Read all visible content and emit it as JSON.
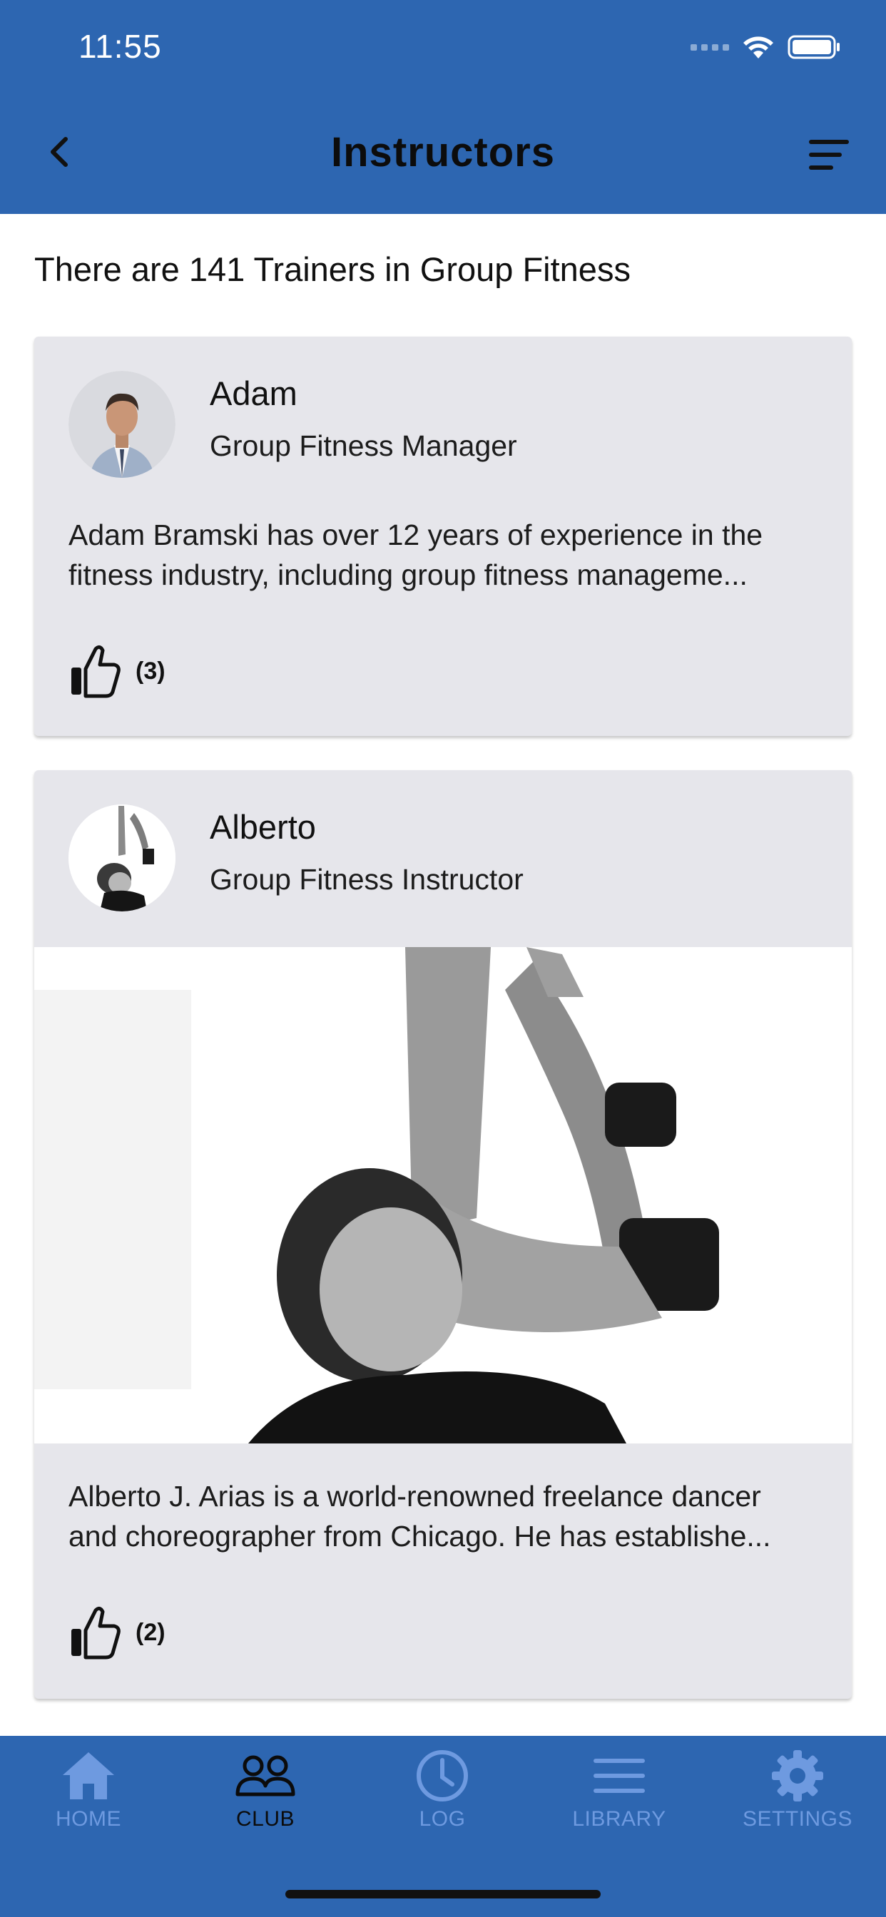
{
  "status_bar": {
    "time": "11:55"
  },
  "header": {
    "title": "Instructors"
  },
  "summary": "There are 141 Trainers in Group Fitness",
  "instructors": [
    {
      "name": "Adam",
      "role": "Group Fitness Manager",
      "bio_line1": "Adam Bramski has over 12 years of experience in the",
      "bio_line2": "fitness industry, including group fitness manageme...",
      "likes": "(3)"
    },
    {
      "name": "Alberto",
      "role": "Group Fitness Instructor",
      "bio_line1": "Alberto J. Arias is a world-renowned freelance dancer",
      "bio_line2": "and choreographer from Chicago. He has establishe...",
      "likes": "(2)"
    }
  ],
  "tabbar": {
    "tabs": [
      {
        "label": "HOME",
        "icon": "home-icon",
        "active": false
      },
      {
        "label": "CLUB",
        "icon": "people-icon",
        "active": true
      },
      {
        "label": "LOG",
        "icon": "clock-icon",
        "active": false
      },
      {
        "label": "LIBRARY",
        "icon": "menu-lines-icon",
        "active": false
      },
      {
        "label": "SETTINGS",
        "icon": "gear-icon",
        "active": false
      }
    ]
  },
  "colors": {
    "brand": "#2d66b1",
    "card": "#e6e6eb",
    "tab_inactive": "#6e9ae0"
  }
}
